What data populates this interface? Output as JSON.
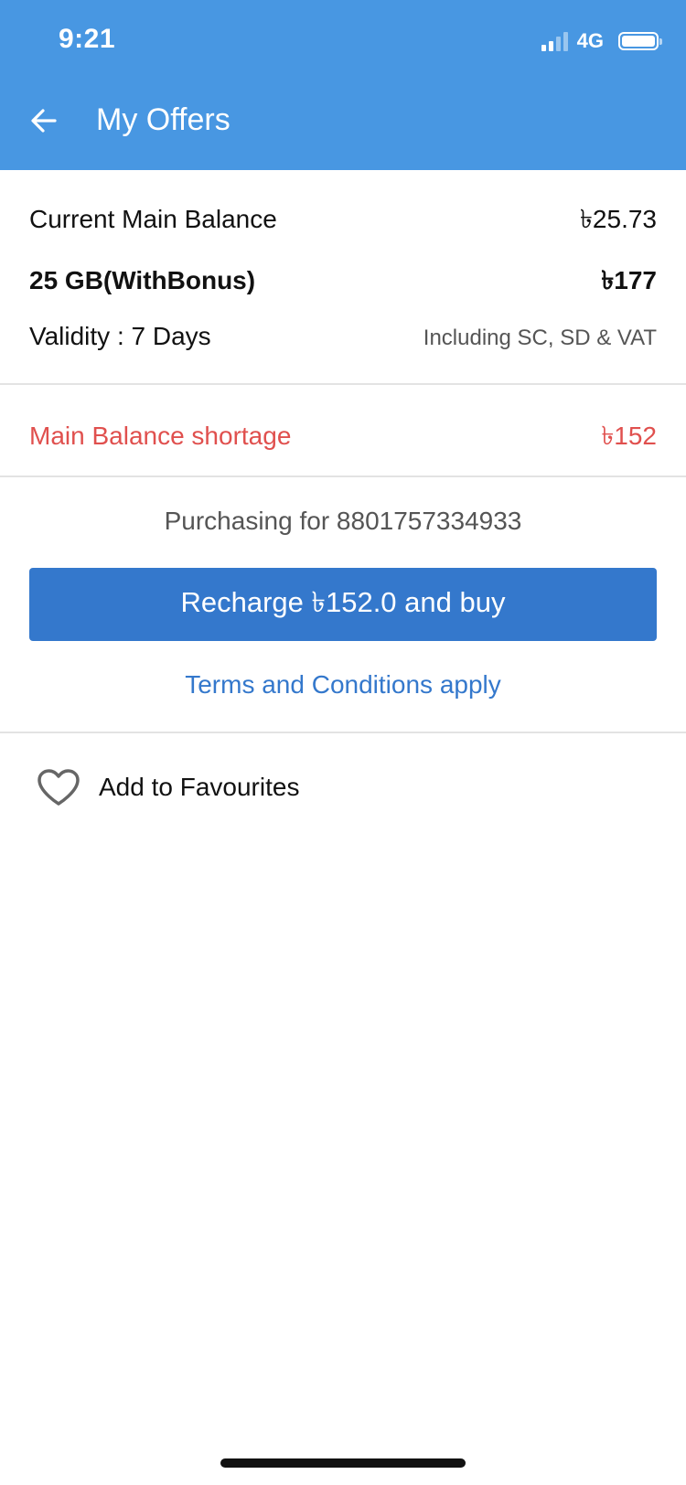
{
  "status_bar": {
    "time": "9:21",
    "network": "4G"
  },
  "header": {
    "back_icon": "arrow-left-icon",
    "title": "My Offers"
  },
  "offer": {
    "current_balance_label": "Current Main Balance",
    "current_balance_value": "৳25.73",
    "pack_name": "25 GB(WithBonus)",
    "pack_price": "৳177",
    "validity": "Validity : 7 Days",
    "tax_note": "Including SC, SD & VAT"
  },
  "shortage": {
    "label": "Main Balance shortage",
    "value": "৳152",
    "color": "#e0504e"
  },
  "purchase": {
    "purchasing_for": "Purchasing for 8801757334933",
    "recharge_button": "Recharge ৳152.0 and buy",
    "terms_link": "Terms and Conditions apply"
  },
  "favourites": {
    "icon": "heart-outline-icon",
    "label": "Add to Favourites"
  },
  "colors": {
    "header_bg": "#4897e2",
    "primary": "#3478cc"
  }
}
